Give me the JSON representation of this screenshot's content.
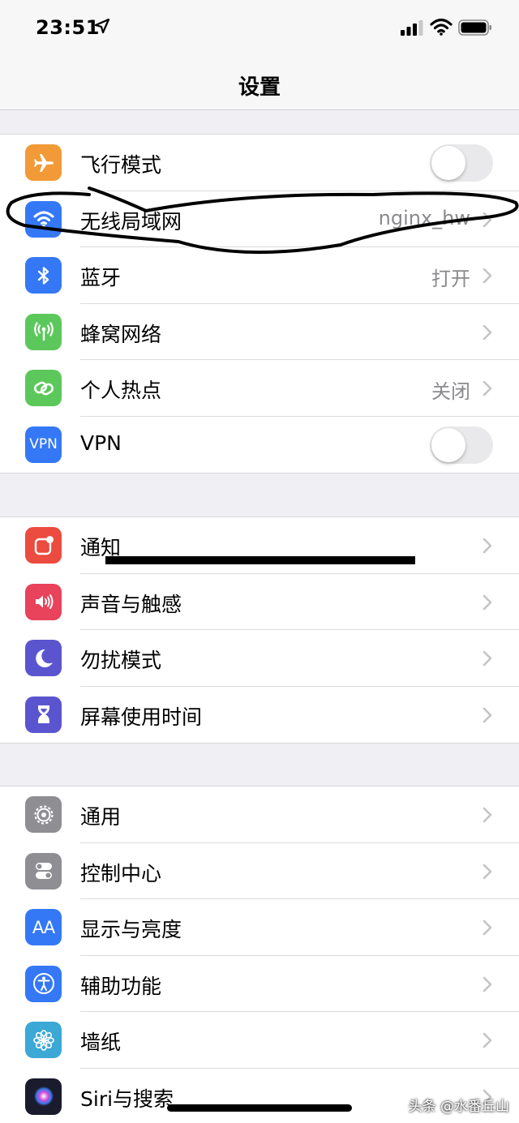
{
  "status_bar": {
    "time": "23:51"
  },
  "nav": {
    "title": "设置"
  },
  "groups": [
    [
      {
        "label": "飞行模式",
        "control": "toggle",
        "icon": "airplane-icon",
        "color": "#f19a37"
      },
      {
        "label": "无线局域网",
        "value": "nginx_hw",
        "control": "chevron",
        "icon": "wifi-icon",
        "color": "#3478f6"
      },
      {
        "label": "蓝牙",
        "value": "打开",
        "control": "chevron",
        "icon": "bluetooth-icon",
        "color": "#3478f6"
      },
      {
        "label": "蜂窝网络",
        "control": "chevron",
        "icon": "cellular-icon",
        "color": "#5cc85b"
      },
      {
        "label": "个人热点",
        "value": "关闭",
        "control": "chevron",
        "icon": "hotspot-icon",
        "color": "#5cc85b"
      },
      {
        "label": "VPN",
        "icon_text": "VPN",
        "control": "toggle",
        "icon": "vpn-icon",
        "color": "#3478f6"
      }
    ],
    [
      {
        "label": "通知",
        "control": "chevron",
        "icon": "notifications-icon",
        "color": "#ec4b3f"
      },
      {
        "label": "声音与触感",
        "control": "chevron",
        "icon": "speaker-icon",
        "color": "#e9425b"
      },
      {
        "label": "勿扰模式",
        "control": "chevron",
        "icon": "moon-icon",
        "color": "#5a55cf"
      },
      {
        "label": "屏幕使用时间",
        "control": "chevron",
        "icon": "hourglass-icon",
        "color": "#5a55cf"
      }
    ],
    [
      {
        "label": "通用",
        "control": "chevron",
        "icon": "gear-icon",
        "color": "#8e8e93"
      },
      {
        "label": "控制中心",
        "control": "chevron",
        "icon": "switches-icon",
        "color": "#8e8e93"
      },
      {
        "label": "显示与亮度",
        "icon_text": "AA",
        "control": "chevron",
        "icon": "text-size-icon",
        "color": "#3478f6"
      },
      {
        "label": "辅助功能",
        "control": "chevron",
        "icon": "accessibility-icon",
        "color": "#3478f6"
      },
      {
        "label": "墙纸",
        "control": "chevron",
        "icon": "wallpaper-flower-icon",
        "color": "#3ba8d6"
      },
      {
        "label": "Siri与搜索",
        "control": "chevron",
        "icon": "siri-icon",
        "color": "#1b1b2e"
      }
    ]
  ],
  "watermark": "头条 @水番丘山"
}
